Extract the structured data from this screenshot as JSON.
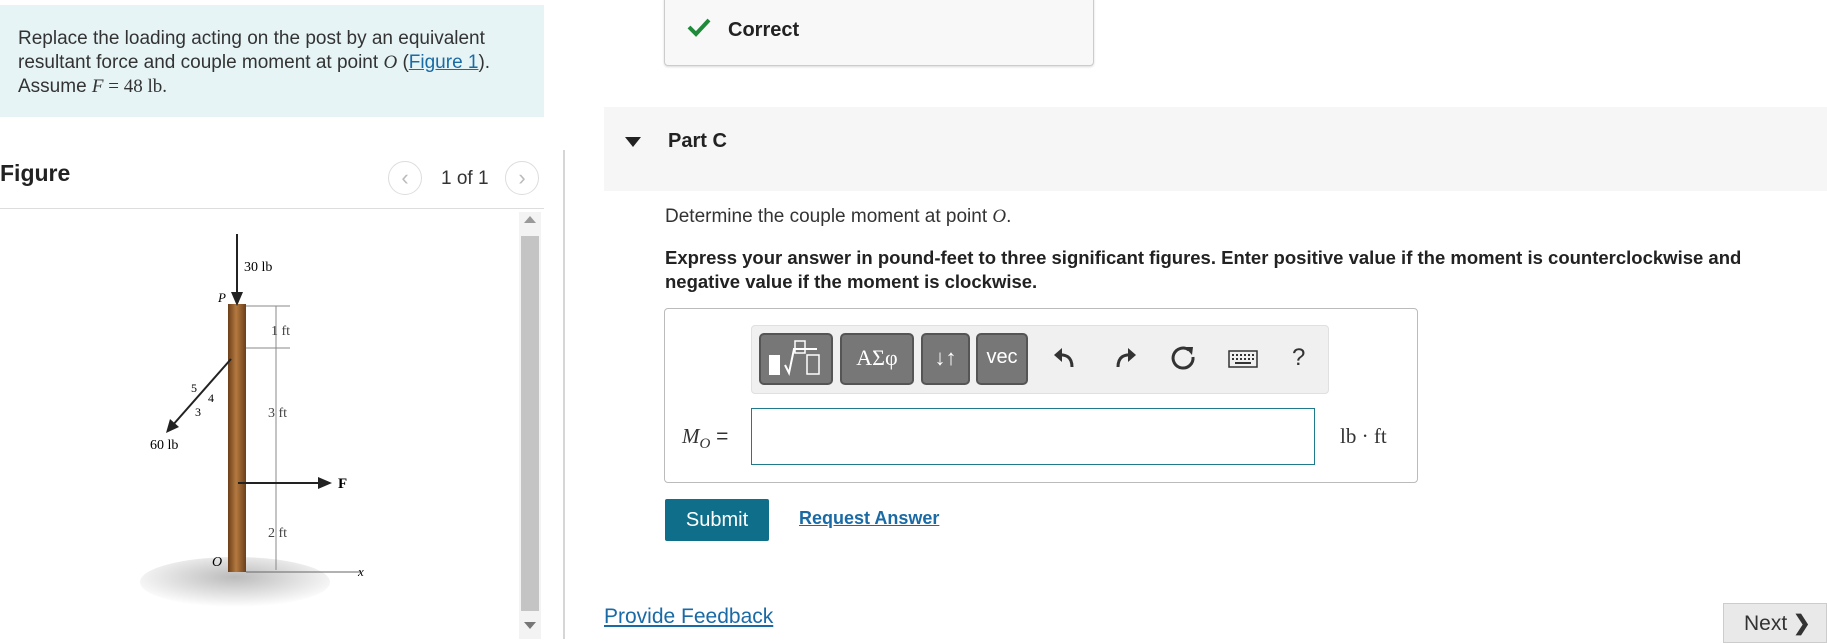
{
  "problem": {
    "line1": "Replace the loading acting on the post by an equivalent",
    "line2_pre": "resultant force and couple moment at point ",
    "point": "O",
    "line2_mid": " (",
    "figure_link": "Figure 1",
    "line2_post": ").",
    "line3_pre": "Assume ",
    "var_f": "F",
    "line3_val": " = 48 lb."
  },
  "figure": {
    "title": "Figure",
    "counter": "1 of 1",
    "labels": {
      "load_30": "30 lb",
      "p": "P",
      "d1": "1 ft",
      "d3": "3 ft",
      "d2": "2 ft",
      "load_60": "60 lb",
      "r5": "5",
      "r4": "4",
      "r3": "3",
      "f": "F",
      "o": "O",
      "x": "x"
    }
  },
  "status": {
    "text": "Correct",
    "color": "#1f8a3a"
  },
  "part": {
    "title": "Part C",
    "question_pre": "Determine the couple moment at point ",
    "question_point": "O",
    "question_post": ".",
    "instructions": "Express your answer in pound-feet to three significant figures. Enter positive value if the moment is counterclockwise and negative value if the moment is clockwise."
  },
  "toolbar": {
    "greek": "ΑΣφ",
    "arrows": "↓↑",
    "vec": "vec",
    "help": "?"
  },
  "answer": {
    "label": "M",
    "label_sub": "O",
    "label_eq": " =",
    "value": "",
    "placeholder": "",
    "units": "lb · ft"
  },
  "actions": {
    "submit": "Submit",
    "request": "Request Answer",
    "feedback": "Provide Feedback",
    "next": "Next"
  },
  "colors": {
    "accent": "#0f6f8a",
    "link": "#1a6aa5",
    "problem_bg": "#e6f4f5",
    "post": "#8b5a2b"
  }
}
